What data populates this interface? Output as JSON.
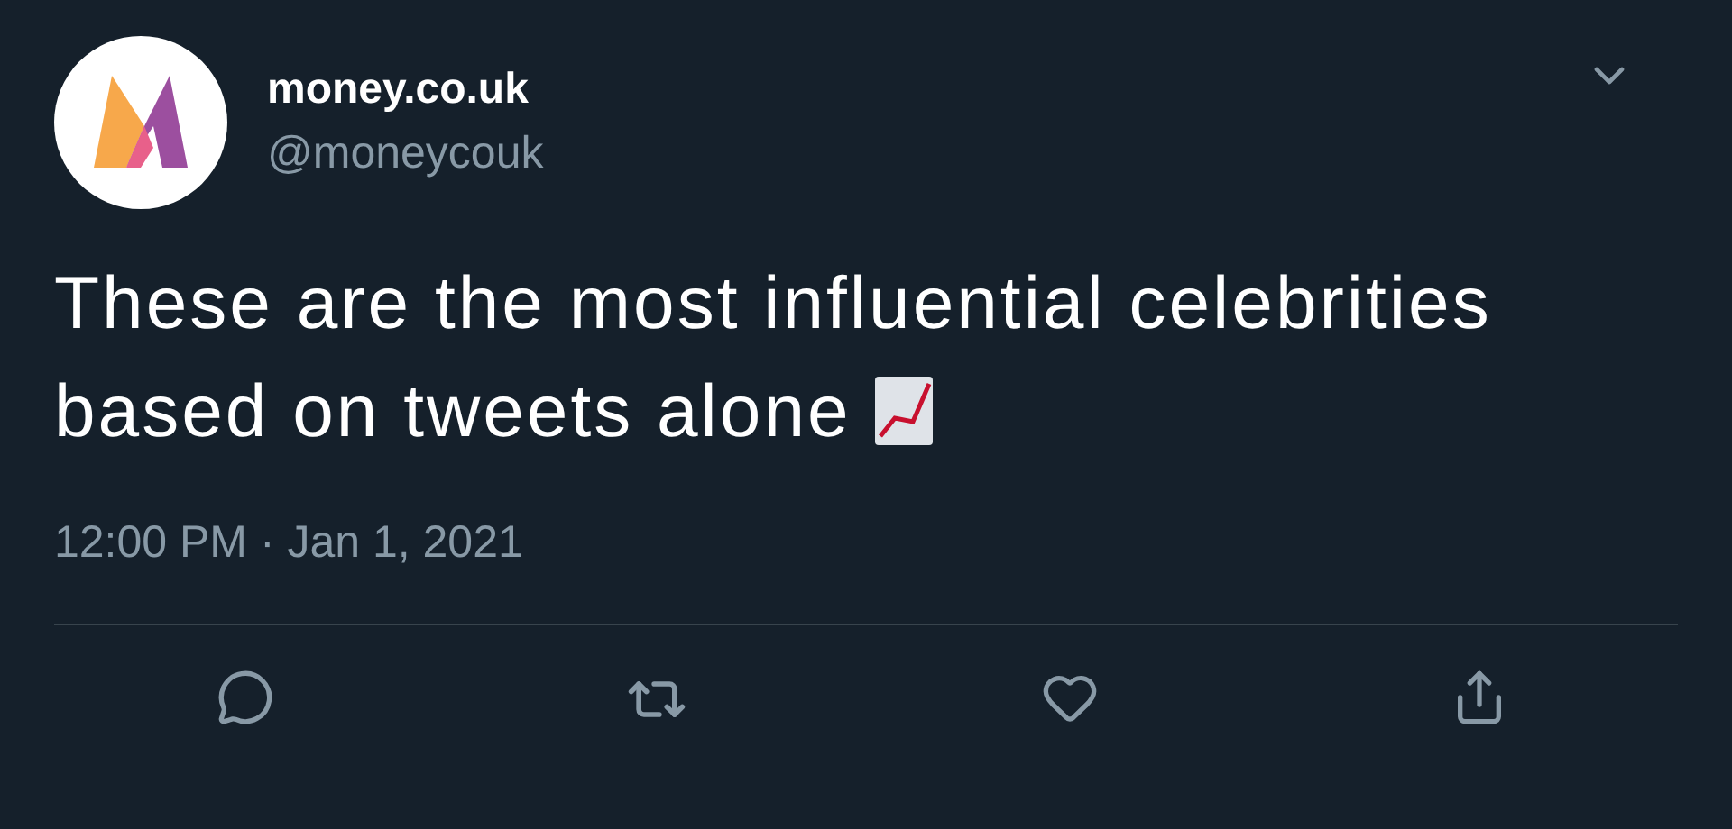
{
  "tweet": {
    "name": "money.co.uk",
    "handle": "@moneycouk",
    "text_lines": [
      "These are the most influential celebrities",
      "based on tweets alone"
    ],
    "timestamp": "12:00 PM · Jan 1, 2021"
  }
}
